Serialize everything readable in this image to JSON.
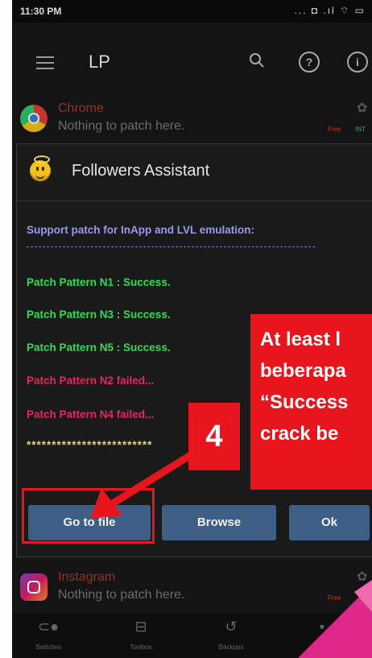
{
  "status_bar": {
    "time": "11:30 PM",
    "icons": "... ◘ .ıl ⌔ ▭"
  },
  "app_bar": {
    "title": "LP"
  },
  "rows": [
    {
      "name": "Chrome",
      "subtitle": "Nothing to patch here.",
      "badge_left": "Free",
      "badge_right": "INT"
    },
    {
      "name": "Instagram",
      "subtitle": "Nothing to patch here.",
      "badge_left": "Free",
      "badge_right": ""
    }
  ],
  "dialog": {
    "title": "Followers Assistant",
    "header_line": "Support patch for InApp and LVL emulation:",
    "log_lines": [
      {
        "text": "Patch Pattern N1 : Success.",
        "status": "success"
      },
      {
        "text": "Patch Pattern N3 : Success.",
        "status": "success"
      },
      {
        "text": "Patch Pattern N5 : Success.",
        "status": "success"
      },
      {
        "text": "Patch Pattern N2 failed...",
        "status": "failed"
      },
      {
        "text": "Patch Pattern N4 failed...",
        "status": "failed"
      }
    ],
    "stars": "*************************",
    "buttons": {
      "go_to_file": "Go to file",
      "browse": "Browse",
      "ok": "Ok"
    }
  },
  "annotation": {
    "step_number": "4",
    "callout_lines": [
      "At least l",
      "beberapa",
      "“Success",
      "crack be"
    ]
  },
  "bottom_nav": [
    {
      "label": "Switches",
      "icon": "toggle-icon"
    },
    {
      "label": "Toolbox",
      "icon": "toolbox-icon"
    },
    {
      "label": "Backups",
      "icon": "backup-icon"
    },
    {
      "label": "",
      "icon": "more-icon"
    }
  ],
  "colors": {
    "success": "#2fdc54",
    "failed": "#e0285c",
    "header_line": "#9b97f4",
    "stars": "#e6d566",
    "button": "#3d5f86",
    "annotation_red": "#e8161c",
    "corner_magenta": "#e0288a"
  }
}
